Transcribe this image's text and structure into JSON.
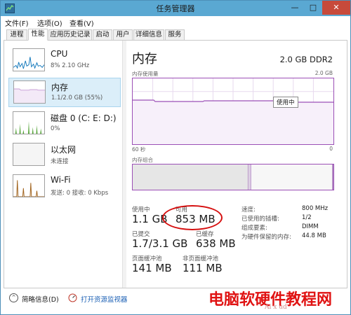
{
  "window": {
    "title": "任务管理器",
    "min": "—",
    "max": "□",
    "close": "✕"
  },
  "menu": [
    "文件(F)",
    "选项(O)",
    "查看(V)"
  ],
  "tabs": [
    "进程",
    "性能",
    "应用历史记录",
    "启动",
    "用户",
    "详细信息",
    "服务"
  ],
  "sidebar": [
    {
      "name": "CPU",
      "value": "8% 2.10 GHz"
    },
    {
      "name": "内存",
      "value": "1.1/2.0 GB (55%)"
    },
    {
      "name": "磁盘 0 (C: E: D:)",
      "value": "0%"
    },
    {
      "name": "以太网",
      "value": "未连接"
    },
    {
      "name": "Wi-Fi",
      "value": "发送: 0 接收: 0 Kbps"
    }
  ],
  "main": {
    "title": "内存",
    "spec": "2.0 GB DDR2",
    "usage_label": "内存使用量",
    "usage_max": "2.0 GB",
    "axis_left": "60 秒",
    "axis_right": "0",
    "tooltip": "使用中",
    "composition_label": "内存组合"
  },
  "stats": [
    {
      "label": "使用中",
      "value": "1.1 GB"
    },
    {
      "label": "可用",
      "value": "853 MB"
    },
    {
      "label": "已提交",
      "value": "1.7/3.1 GB"
    },
    {
      "label": "已缓存",
      "value": "638 MB"
    },
    {
      "label": "页面缓冲池",
      "value": "141 MB"
    },
    {
      "label": "非页面缓冲池",
      "value": "111 MB"
    }
  ],
  "details": [
    {
      "label": "速度:",
      "value": "800 MHz"
    },
    {
      "label": "已使用的插槽:",
      "value": "1/2"
    },
    {
      "label": "组成要素:",
      "value": "DIMM"
    },
    {
      "label": "为硬件保留的内存:",
      "value": "44.8 MB"
    }
  ],
  "footer": {
    "brief": "简略信息(D)",
    "monitor": "打开资源监视器"
  },
  "watermark": {
    "main": "电脑软硬件教程网",
    "sub": "Ai x ud"
  },
  "colors": {
    "accent": "#9b4fb6",
    "cpu": "#1177bb",
    "green": "#4da02f",
    "wifi": "#a0621b",
    "highlight": "#d60f0f"
  }
}
